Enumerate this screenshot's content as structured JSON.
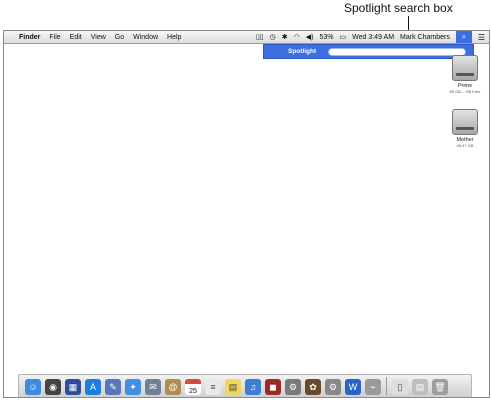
{
  "callout": {
    "text": "Spotlight search box"
  },
  "menubar": {
    "apple": "",
    "items": [
      "Finder",
      "File",
      "Edit",
      "View",
      "Go",
      "Window",
      "Help"
    ],
    "battery": "53%",
    "clock": "Wed 3:49 AM",
    "user": "Mark Chambers"
  },
  "spotlight": {
    "label": "Spotlight",
    "query": ""
  },
  "desktop": {
    "drives": [
      {
        "name": "Prime",
        "sub": "80 GB... GB Free"
      },
      {
        "name": "Mother",
        "sub": "49.47 GB"
      }
    ]
  },
  "dock": {
    "calendar_date": "25",
    "icons": [
      {
        "name": "finder-icon",
        "color": "#3d8be0",
        "glyph": "☺"
      },
      {
        "name": "dashboard-icon",
        "color": "#444444",
        "glyph": "◉"
      },
      {
        "name": "expose-icon",
        "color": "#2b4d9a",
        "glyph": "▦"
      },
      {
        "name": "app-store-icon",
        "color": "#1f7de0",
        "glyph": "A"
      },
      {
        "name": "preview-icon",
        "color": "#5877b8",
        "glyph": "✎"
      },
      {
        "name": "safari-icon",
        "color": "#3f8fe5",
        "glyph": "✦"
      },
      {
        "name": "mail-icon",
        "color": "#6f7f96",
        "glyph": "✉"
      },
      {
        "name": "address-book-icon",
        "color": "#b08b52",
        "glyph": "@"
      },
      {
        "name": "ical-icon",
        "color": "#d84a3a",
        "glyph": ""
      },
      {
        "name": "textedit-icon",
        "color": "#e9e9e9",
        "glyph": "≡"
      },
      {
        "name": "stickies-icon",
        "color": "#f3d55b",
        "glyph": "▤"
      },
      {
        "name": "itunes-icon",
        "color": "#3b7fd4",
        "glyph": "♫"
      },
      {
        "name": "photo-booth-icon",
        "color": "#9c2b23",
        "glyph": "◼"
      },
      {
        "name": "automator-icon",
        "color": "#7a7a7a",
        "glyph": "⚙"
      },
      {
        "name": "iphoto-icon",
        "color": "#6b4a2a",
        "glyph": "✿"
      },
      {
        "name": "system-prefs-icon",
        "color": "#888888",
        "glyph": "⚙"
      },
      {
        "name": "word-icon",
        "color": "#2a64c8",
        "glyph": "W"
      },
      {
        "name": "grapher-icon",
        "color": "#9a9a9a",
        "glyph": "⌁"
      },
      {
        "name": "sep"
      },
      {
        "name": "document-icon",
        "color": "#dedede",
        "glyph": "▯"
      },
      {
        "name": "applications-stack-icon",
        "color": "#bdbdbd",
        "glyph": "▤"
      },
      {
        "name": "trash-icon",
        "color": "#9e9e9e",
        "glyph": "🗑"
      }
    ]
  }
}
